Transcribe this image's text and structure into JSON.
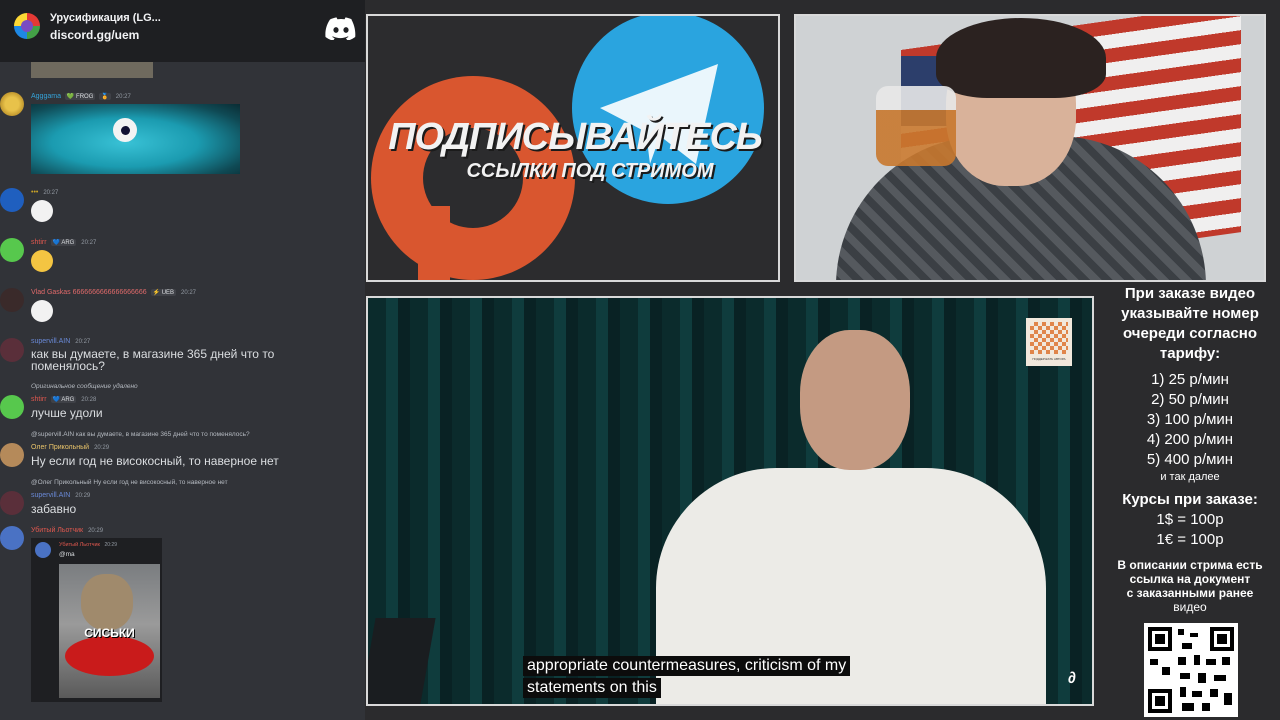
{
  "server": {
    "name": "Урусификация (LG...",
    "invite": "discord.gg/uem"
  },
  "messages": [
    {
      "user": "Agggama",
      "badges": [
        "💚 FROG",
        "🏅"
      ],
      "time": "20:27"
    },
    {
      "user": "•••",
      "time": "20:27"
    },
    {
      "user": "shtirr",
      "badges": [
        "💙 ARG"
      ],
      "time": "20:27"
    },
    {
      "user": "Vlad Gaskas 6666666666666666666",
      "badges": [
        "⚡ UEB"
      ],
      "time": "20:27"
    },
    {
      "user": "supervill.AIN",
      "time": "20:27",
      "text": "как вы думаете, в магазине 365 дней что то",
      "text2": "поменялось?"
    },
    {
      "reply": "Оригинальное сообщение удалено",
      "user": "shtirr",
      "badges": [
        "💙 ARG"
      ],
      "time": "20:28",
      "text": "лучше удоли"
    },
    {
      "reply": "@supervill.AIN как вы думаете, в магазине 365 дней что то поменялось?",
      "user": "Олег Прикольный",
      "time": "20:29",
      "text": "Ну если год не високосный, то наверное нет"
    },
    {
      "reply": "@Олег Прикольный Ну если год не високосный, то наверное нет",
      "user": "supervill.AIN",
      "time": "20:29",
      "text": "забавно"
    },
    {
      "user": "Убитый Льотчик",
      "time": "20:29",
      "embed_user": "Убитый Льотчик",
      "embed_time": "20:29",
      "embed_mention": "@ma",
      "embed_image_caption": "СИСЬКИ"
    }
  ],
  "promo": {
    "title": "ПОДПИСЫВАЙТЕСЬ",
    "subtitle": "ССЫЛКИ ПОД СТРИМОМ"
  },
  "main_video": {
    "subtitle_line1": "appropriate countermeasures, criticism of my",
    "subtitle_line2": "statements on this",
    "qr_caption": "ПОДДЕРЖАТЬ АВТОРА"
  },
  "info": {
    "intro": [
      "При заказе видео",
      "указывайте номер",
      "очереди согласно",
      "тарифу:"
    ],
    "prices": [
      "1) 25 р/мин",
      "2) 50 р/мин",
      "3) 100 р/мин",
      "4) 200 р/мин",
      "5) 400 р/мин"
    ],
    "etc": "и так далее",
    "rates_title": "Курсы при заказе:",
    "rates": [
      "1$ = 100р",
      "1€ = 100р"
    ],
    "note": [
      "В описании стрима есть",
      "ссылка на документ",
      "с заказанными ранее",
      "видео"
    ]
  },
  "colors": {
    "discord_bg": "#313338",
    "discord_header": "#1e1f22",
    "telegram": "#2aa4df",
    "patreon": "#d9562f"
  }
}
